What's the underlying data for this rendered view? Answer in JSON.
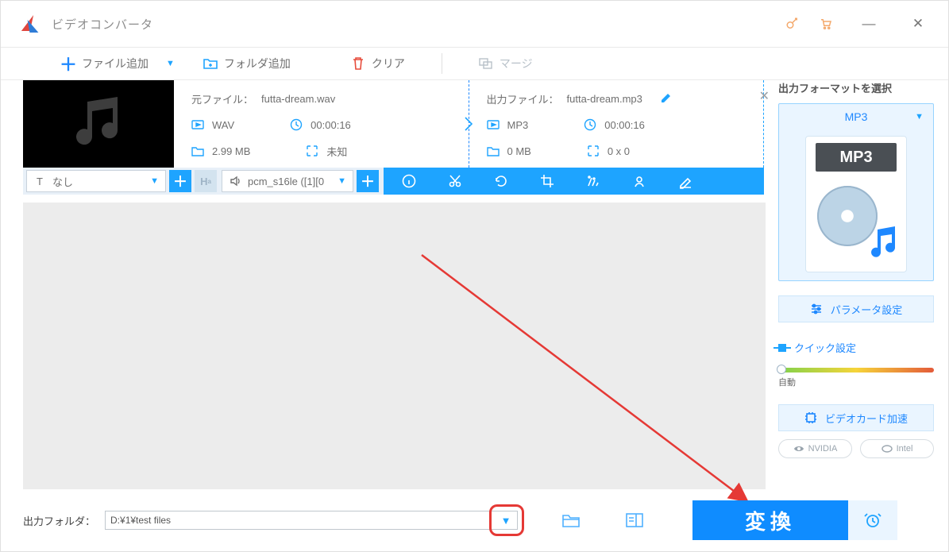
{
  "titlebar": {
    "title": "ビデオコンバータ"
  },
  "toolbar": {
    "add_file": "ファイル追加",
    "add_folder": "フォルダ追加",
    "clear": "クリア",
    "merge": "マージ"
  },
  "file": {
    "source": {
      "label": "元ファイル：",
      "name": "futta-dream.wav",
      "format": "WAV",
      "duration": "00:00:16",
      "size": "2.99 MB",
      "dimensions": "未知"
    },
    "output": {
      "label": "出力ファイル：",
      "name": "futta-dream.mp3",
      "format": "MP3",
      "duration": "00:00:16",
      "size": "0 MB",
      "dimensions": "0 x 0"
    }
  },
  "strip": {
    "subtitle_label": "なし",
    "audio_codec": "pcm_s16le ([1][0"
  },
  "rpanel": {
    "title": "出力フォーマットを選択",
    "format_selected": "MP3",
    "format_badge": "MP3",
    "param_settings": "パラメータ設定",
    "quick_settings": "クイック設定",
    "auto_label": "自動",
    "gpu_label": "ビデオカード加速",
    "chip_nvidia": "NVIDIA",
    "chip_intel": "Intel"
  },
  "footer": {
    "output_folder_label": "出力フォルダ：",
    "output_folder_path": "D:¥1¥test files",
    "convert": "変換"
  }
}
